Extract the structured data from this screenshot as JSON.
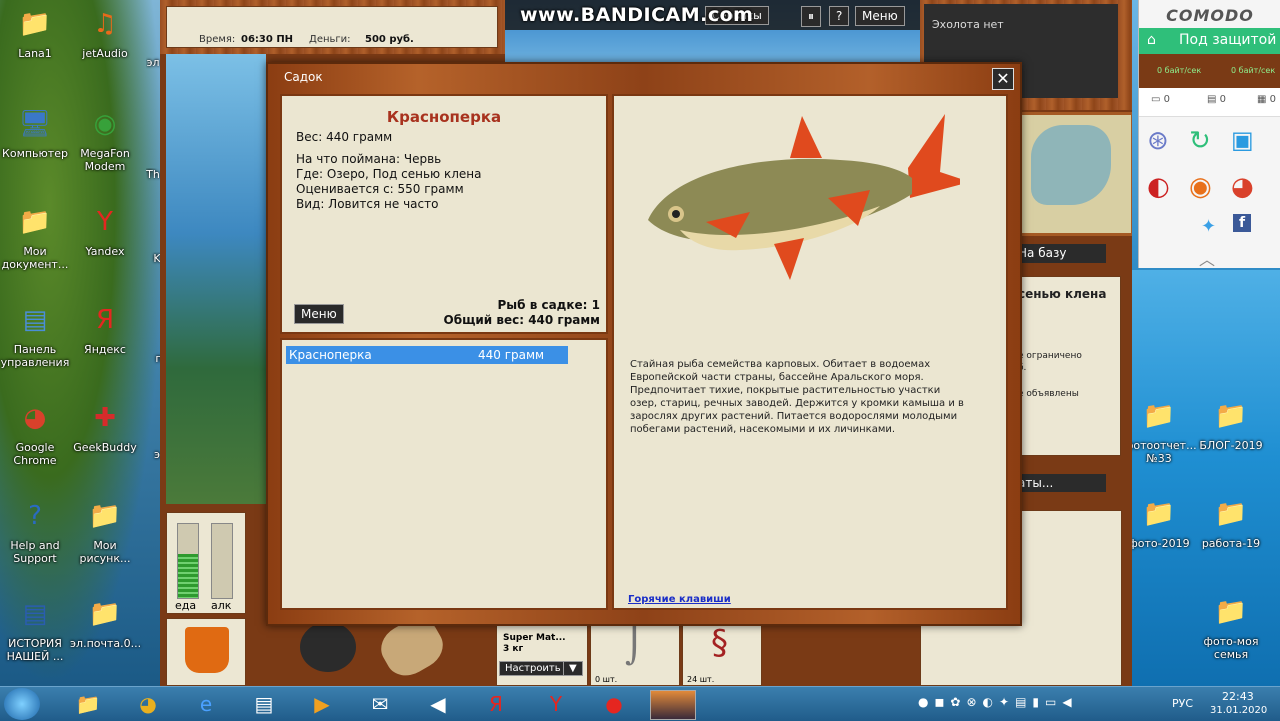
{
  "watermark": "www.BANDICAM.com",
  "desktop": {
    "left_icons": [
      {
        "label": "Lana1",
        "glyph": "📁",
        "color": "#e3b54a"
      },
      {
        "label": "jetAudio",
        "glyph": "♫",
        "color": "#e86a1a"
      },
      {
        "label": "Компьютер",
        "glyph": "🖥",
        "color": "#3a78c8"
      },
      {
        "label": "MegaFon Modem",
        "glyph": "◉",
        "color": "#37a13a"
      },
      {
        "label": "Мои документ...",
        "glyph": "📁",
        "color": "#e3b54a"
      },
      {
        "label": "Yandex",
        "glyph": "Y",
        "color": "#e52620"
      },
      {
        "label": "Панель управления",
        "glyph": "▤",
        "color": "#4a8ed8"
      },
      {
        "label": "Яндекс",
        "glyph": "Я",
        "color": "#e52620"
      },
      {
        "label": "Google Chrome",
        "glyph": "◕",
        "color": "#d9412b"
      },
      {
        "label": "GeekBuddy",
        "glyph": "✚",
        "color": "#d62b2b"
      },
      {
        "label": "Help and Support",
        "glyph": "?",
        "color": "#2a6bc1"
      },
      {
        "label": "Мои рисунк...",
        "glyph": "📁",
        "color": "#e3b54a"
      },
      {
        "label": "ИСТОРИЯ НАШЕЙ ...",
        "glyph": "▤",
        "color": "#2a5db0"
      },
      {
        "label": "эл.почта.0...",
        "glyph": "📁",
        "color": "#e3b54a"
      }
    ],
    "partial_labels": [
      "эл",
      "Th",
      "K",
      "п",
      "э"
    ],
    "right_icons": [
      {
        "label": "фотоотчет... №33",
        "glyph": "📁",
        "color": "#e3b54a"
      },
      {
        "label": "БЛОГ-2019",
        "glyph": "📁",
        "color": "#e3b54a"
      },
      {
        "label": "фото-2019",
        "glyph": "📁",
        "color": "#a0631d"
      },
      {
        "label": "работа-19",
        "glyph": "📁",
        "color": "#e3b54a"
      },
      {
        "label": "фото-моя семья",
        "glyph": "📁",
        "color": "#e3b54a"
      }
    ]
  },
  "game": {
    "time_label": "Время:",
    "time_value": "06:30 ПН",
    "money_label": "Деньги:",
    "money_value": "500 руб.",
    "top_buttons": [
      "Сервисы",
      "Меню"
    ],
    "echo": "Эхолота нет",
    "to_base": "На базу",
    "location": "сенью клена",
    "side_text": [
      "е ограничено",
      "б.",
      "е объявлены"
    ],
    "side_button": "аты...",
    "meter_labels": [
      "еда",
      "алк"
    ],
    "bait": {
      "name": "Super Mat...",
      "weight": "3 кг"
    },
    "setup_button": "Настроить",
    "inv_counts": [
      "0 шт.",
      "24 шт."
    ]
  },
  "dialog": {
    "title": "Садок",
    "close": "✕",
    "fish": {
      "name": "Красноперка",
      "weight_line": "Вес: 440 грамм",
      "caught_on": "На что поймана: Червь",
      "where": "Где: Озеро, Под сенью клена",
      "valued": "Оценивается с: 550 грамм",
      "kind": "Вид: Ловится не часто"
    },
    "menu_button": "Меню",
    "count_line": "Рыб в садке: 1",
    "total_line": "Общий вес: 440 грамм",
    "list": [
      {
        "name": "Красноперка",
        "weight": "440 грамм"
      }
    ],
    "description": "Стайная рыба семейства карповых. Обитает в водоемах Европейской части страны, бассейне Аральского моря. Предпочитает тихие, покрытые растительностью участки озер, стариц, речных заводей. Держится у кромки камыша и в зарослях других растений. Питается водорослями молодыми побегами растений, насекомыми и их личинками.",
    "hotkeys": "Горячие клавиши"
  },
  "comodo": {
    "brand": "COMODO",
    "status": "Под защитой",
    "rate_left": "0 байт/сек",
    "rate_right": "0 байт/сек",
    "counts": [
      "0",
      "0",
      "0"
    ]
  },
  "taskbar": {
    "lang": "РУС",
    "time": "22:43",
    "date": "31.01.2020"
  }
}
